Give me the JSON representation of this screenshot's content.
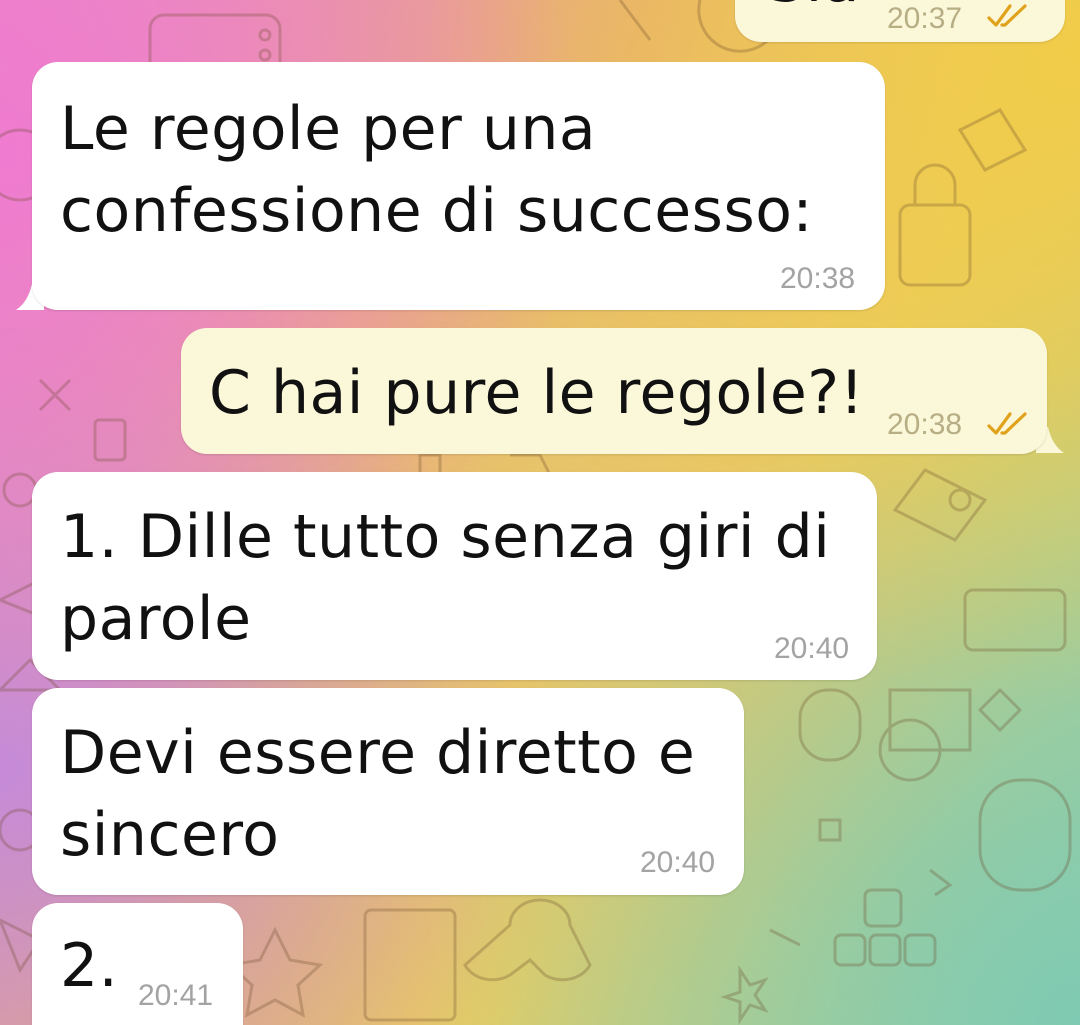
{
  "messages": [
    {
      "id": "m0",
      "direction": "out",
      "text_lines": [
        "Sia"
      ],
      "time": "20:37",
      "read": true
    },
    {
      "id": "m1",
      "direction": "in",
      "text_lines": [
        "Le regole per una",
        "confessione di successo:"
      ],
      "time": "20:38"
    },
    {
      "id": "m2",
      "direction": "out",
      "text_lines": [
        "C hai pure le regole?!"
      ],
      "time": "20:38",
      "read": true
    },
    {
      "id": "m3",
      "direction": "in",
      "text_lines": [
        "1. Dille tutto senza giri di",
        "parole"
      ],
      "time": "20:40"
    },
    {
      "id": "m4",
      "direction": "in",
      "text_lines": [
        "Devi essere diretto e",
        "sincero"
      ],
      "time": "20:40"
    },
    {
      "id": "m5",
      "direction": "in",
      "text_lines": [
        "2."
      ],
      "time": "20:41"
    }
  ],
  "icons": {
    "read_receipt": "double-check-icon",
    "wallpaper": "game-doodles-pattern"
  },
  "colors": {
    "incoming_bubble": "#ffffff",
    "outgoing_bubble": "#fbf7d9",
    "read_ticks": "#e0a21a",
    "timestamp_in": "#a3a3a3",
    "timestamp_out": "#b8ae86"
  }
}
